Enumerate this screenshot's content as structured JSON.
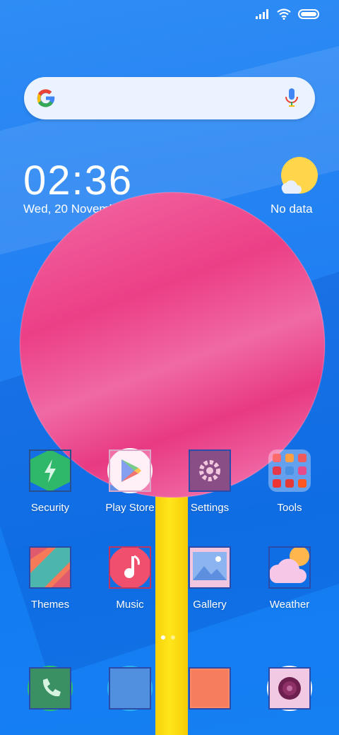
{
  "status_bar": {
    "signal_icon": "signal-icon",
    "wifi_icon": "wifi-icon",
    "battery_icon": "battery-icon"
  },
  "search": {
    "logo": "google-icon",
    "mic": "mic-icon"
  },
  "clock": {
    "time": "02:36",
    "date": "Wed, 20 November"
  },
  "weather_widget": {
    "icon": "sun-cloud-icon",
    "text": "No data"
  },
  "apps_row1": [
    {
      "label": "Security",
      "icon": "security-icon"
    },
    {
      "label": "Play Store",
      "icon": "play-store-icon"
    },
    {
      "label": "Settings",
      "icon": "settings-icon"
    },
    {
      "label": "Tools",
      "icon": "tools-folder-icon"
    }
  ],
  "apps_row2": [
    {
      "label": "Themes",
      "icon": "themes-icon"
    },
    {
      "label": "Music",
      "icon": "music-icon"
    },
    {
      "label": "Gallery",
      "icon": "gallery-icon"
    },
    {
      "label": "Weather",
      "icon": "weather-icon"
    }
  ],
  "dock": [
    {
      "icon": "phone-icon"
    },
    {
      "icon": "messages-icon"
    },
    {
      "icon": "browser-icon"
    },
    {
      "icon": "camera-icon"
    }
  ],
  "page_indicator": {
    "pages": 2,
    "current": 1
  }
}
